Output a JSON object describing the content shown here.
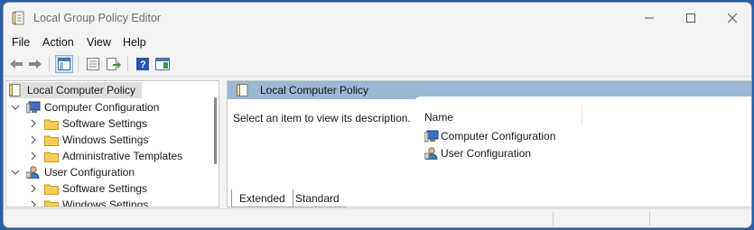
{
  "window": {
    "title": "Local Group Policy Editor"
  },
  "menu": [
    "File",
    "Action",
    "View",
    "Help"
  ],
  "toolbar": {
    "buttons": [
      "back-icon",
      "forward-icon",
      "show-hide-tree-icon",
      "properties-icon",
      "export-list-icon",
      "help-icon",
      "show-action-pane-icon"
    ]
  },
  "tree": {
    "root": "Local Computer Policy",
    "computer_configuration": {
      "label": "Computer Configuration",
      "children": [
        "Software Settings",
        "Windows Settings",
        "Administrative Templates"
      ]
    },
    "user_configuration": {
      "label": "User Configuration",
      "children": [
        "Software Settings",
        "Windows Settings"
      ]
    }
  },
  "details": {
    "header_title": "Local Computer Policy",
    "description_prompt": "Select an item to view its description.",
    "column_name": "Name",
    "items": [
      "Computer Configuration",
      "User Configuration"
    ]
  },
  "tabs": [
    "Extended",
    "Standard"
  ],
  "colors": {
    "banner": "#9ab7d6",
    "selection": "#dedede",
    "desktop": "#2b5ea8"
  }
}
